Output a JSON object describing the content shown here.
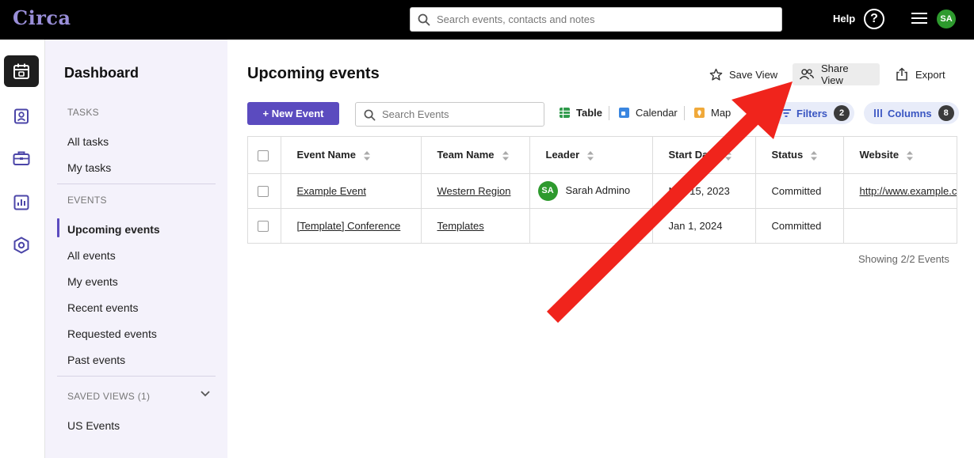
{
  "header": {
    "logo": "Circa",
    "search_placeholder": "Search events, contacts and notes",
    "help_label": "Help",
    "help_icon_glyph": "?",
    "avatar_initials": "SA"
  },
  "rail": {
    "items": [
      "calendar-icon",
      "contact-card-icon",
      "briefcase-icon",
      "bar-chart-icon",
      "settings-hex-icon"
    ],
    "active_item": "calendar-icon"
  },
  "sidebar": {
    "title": "Dashboard",
    "tasks_heading": "TASKS",
    "tasks": [
      "All tasks",
      "My tasks"
    ],
    "events_heading": "EVENTS",
    "events": [
      "Upcoming events",
      "All events",
      "My events",
      "Recent events",
      "Requested events",
      "Past events"
    ],
    "active_item": "Upcoming events",
    "saved_views_heading": "SAVED VIEWS (1)",
    "saved_views": [
      "US Events"
    ]
  },
  "main": {
    "title": "Upcoming events",
    "actions": {
      "save_view": "Save View",
      "share_view": "Share View",
      "export": "Export"
    },
    "new_event_label": "+ New Event",
    "search_placeholder": "Search Events",
    "view_tabs": {
      "table": "Table",
      "calendar": "Calendar",
      "map": "Map",
      "active": "Table"
    },
    "filters": {
      "label": "Filters",
      "count": "2"
    },
    "columns": {
      "label": "Columns",
      "count": "8"
    },
    "table": {
      "headers": [
        "Event Name",
        "Team Name",
        "Leader",
        "Start Date",
        "Status",
        "Website"
      ],
      "rows": [
        {
          "event_name": "Example Event",
          "team_name": "Western Region",
          "leader_initials": "SA",
          "leader_name": "Sarah Admino",
          "start_date": "Nov 15, 2023",
          "status": "Committed",
          "website": "http://www.example.com"
        },
        {
          "event_name": "[Template] Conference",
          "team_name": "Templates",
          "leader_initials": "",
          "leader_name": "",
          "start_date": "Jan 1, 2024",
          "status": "Committed",
          "website": ""
        }
      ]
    },
    "footer_count": "Showing 2/2 Events"
  },
  "colors": {
    "accent": "#5b4bbf",
    "logo": "#9a8fd9",
    "avatar": "#2e9a2e",
    "annotation_arrow": "#f0241c",
    "pill_bg": "#e8ecf9",
    "pill_text": "#3a56c2"
  }
}
